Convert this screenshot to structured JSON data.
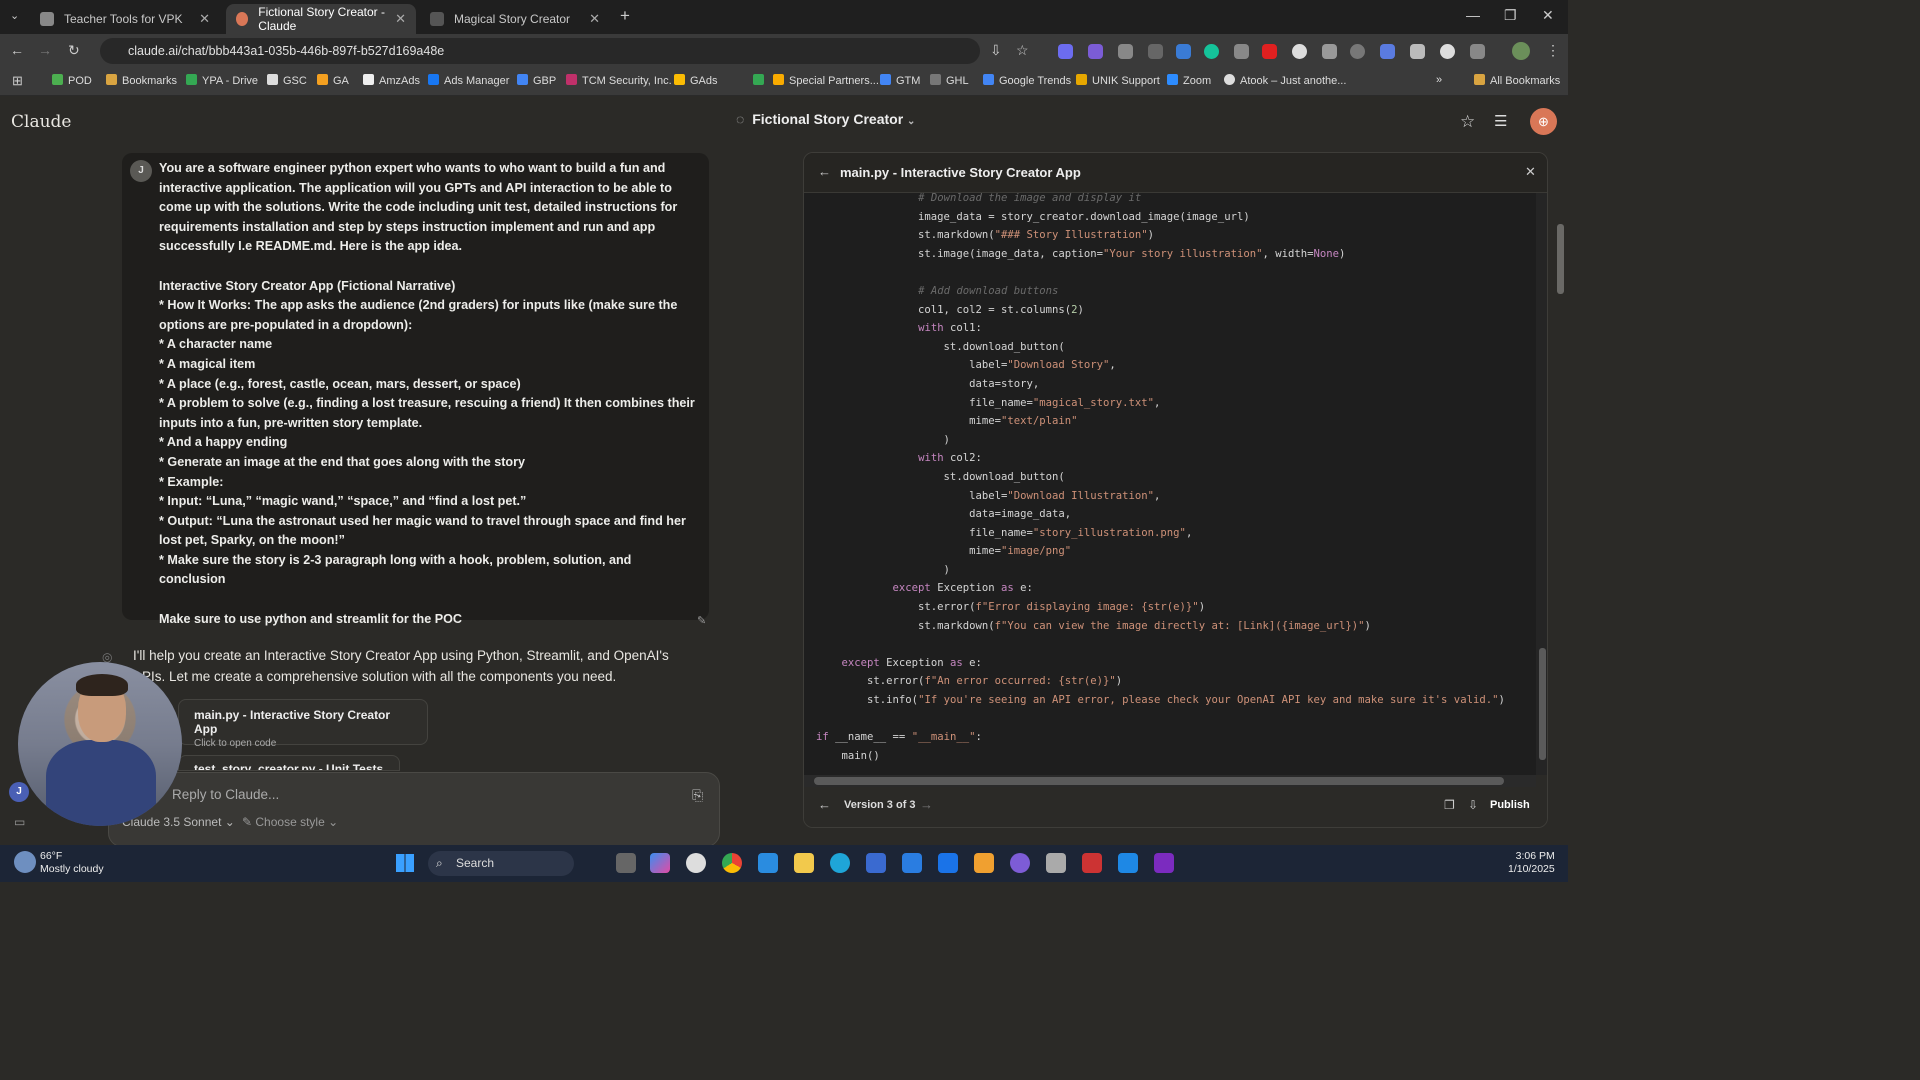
{
  "browser": {
    "tabs": [
      {
        "title": "Teacher Tools for VPK"
      },
      {
        "title": "Fictional Story Creator - Claude"
      },
      {
        "title": "Magical Story Creator"
      }
    ],
    "url": "claude.ai/chat/bbb443a1-035b-446b-897f-b527d169a48e",
    "bookmarks": [
      "POD",
      "Bookmarks",
      "YPA - Drive",
      "GSC",
      "GA",
      "AmzAds",
      "Ads Manager",
      "GBP",
      "TCM Security, Inc.",
      "GAds",
      "Special Partners...",
      "GTM",
      "GHL",
      "Google Trends",
      "UNIK Support",
      "Zoom",
      "Atook – Just anothe..."
    ],
    "all_bookmarks": "All Bookmarks"
  },
  "app": {
    "brand": "Claude",
    "conversation_title": "Fictional Story Creator",
    "user_initial": "J",
    "user_message": [
      "You are a software engineer python expert who wants to who want to build a fun and interactive application. The application will you GPTs and API interaction to be able to come up with the solutions. Write the code including unit test, detailed instructions for requirements installation and step by steps instruction implement and run and app successfully I.e README.md. Here is the app idea.",
      "",
      "Interactive Story Creator App (Fictional Narrative)",
      "* How It Works: The app asks the audience (2nd graders) for inputs like (make sure the options are pre-populated in a dropdown):",
      "   * A character name",
      "   * A magical item",
      "   * A place (e.g., forest, castle, ocean, mars, dessert, or space)",
      "   * A problem to solve (e.g., finding a lost treasure, rescuing a friend) It then combines their inputs into a fun, pre-written story template.",
      "   * And a happy ending",
      "   * Generate an image at the end that goes along with the story",
      "* Example:",
      "   * Input: “Luna,” “magic wand,” “space,” and “find a lost pet.”",
      "   * Output: “Luna the astronaut used her magic wand to travel through space and find her lost pet, Sparky, on the moon!”",
      "* Make sure the story is 2-3 paragraph long with a hook, problem, solution, and conclusion",
      "",
      "Make sure to use python and streamlit for the POC"
    ],
    "assistant_message": "I'll help you create an Interactive Story Creator App using Python, Streamlit, and OpenAI's APIs. Let me create a comprehensive solution with all the components you need.",
    "artifact_card": {
      "title": "main.py - Interactive Story Creator App",
      "subtitle": "Click to open code"
    },
    "artifact_card2": "test_story_creator.py - Unit Tests",
    "input_placeholder": "Reply to Claude...",
    "model": "Claude 3.5 Sonnet",
    "style": "Choose style"
  },
  "panel": {
    "title": "main.py - Interactive Story Creator App",
    "version": "Version 3 of 3",
    "publish": "Publish"
  },
  "taskbar": {
    "weather_temp": "66°F",
    "weather_desc": "Mostly cloudy",
    "search": "Search",
    "time": "3:06 PM",
    "date": "1/10/2025"
  },
  "colors": {
    "accent": "#d97757",
    "background": "#2b2a27",
    "code_bg": "#1e1e1e"
  }
}
